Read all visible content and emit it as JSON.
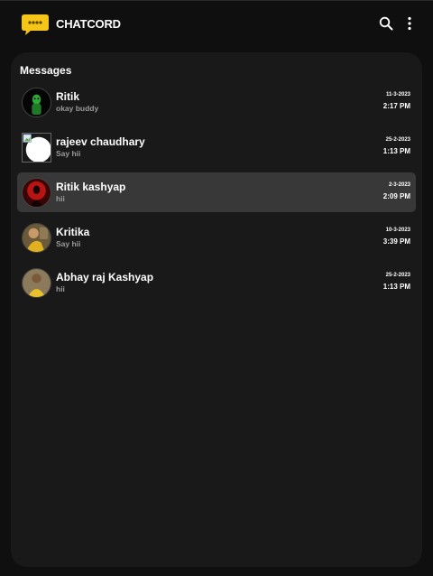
{
  "header": {
    "brand": "CHATCORD",
    "logo_icon": "chat-bubble-icon",
    "search_icon": "search-icon",
    "more_icon": "more-vertical-icon",
    "logo_color": "#f5c518"
  },
  "panel": {
    "title": "Messages"
  },
  "conversations": [
    {
      "name": "Ritik",
      "preview": "okay buddy",
      "date": "11-3-2023",
      "time": "2:17 PM",
      "active": false
    },
    {
      "name": "rajeev chaudhary",
      "preview": "Say hii",
      "date": "25-2-2023",
      "time": "1:13 PM",
      "active": false
    },
    {
      "name": "Ritik kashyap",
      "preview": "hii",
      "date": "2-3-2023",
      "time": "2:09 PM",
      "active": true
    },
    {
      "name": "Kritika",
      "preview": "Say hii",
      "date": "10-3-2023",
      "time": "3:39 PM",
      "active": false
    },
    {
      "name": "Abhay raj Kashyap",
      "preview": "hii",
      "date": "25-2-2023",
      "time": "1:13 PM",
      "active": false
    }
  ],
  "colors": {
    "background": "#0f0f0f",
    "panel": "#191919",
    "active_row": "#383838",
    "muted_text": "#9a9a9a"
  }
}
